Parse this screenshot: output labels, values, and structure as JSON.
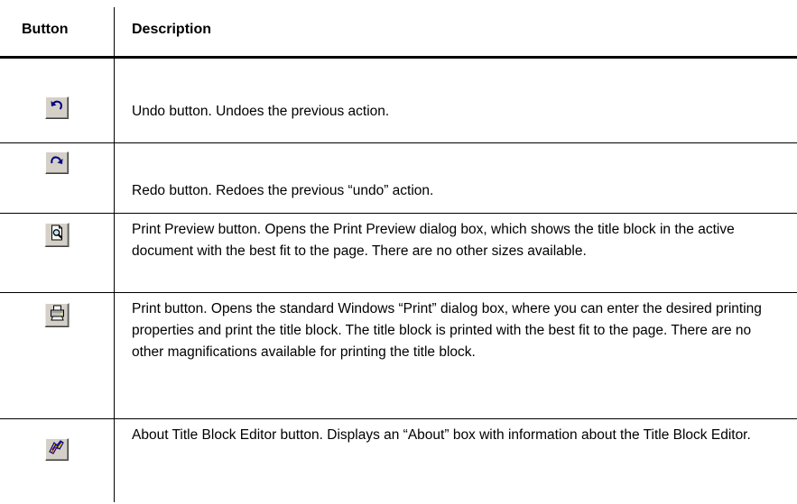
{
  "header": {
    "col_button": "Button",
    "col_description": "Description"
  },
  "rows": [
    {
      "icon": "undo-icon",
      "description": "Undo button. Undoes the previous action."
    },
    {
      "icon": "redo-icon",
      "description": "Redo button. Redoes the previous “undo” action."
    },
    {
      "icon": "print-preview-icon",
      "description": "Print Preview button. Opens the Print Preview dialog box, which shows the title block in the active document with the best fit to the page. There are no other sizes available."
    },
    {
      "icon": "printer-icon",
      "description": "Print button. Opens the standard Windows “Print” dialog box, where you can enter the desired printing properties and print the title block. The title block is printed with the best fit to the page. There are no other magnifications available for printing the title block."
    },
    {
      "icon": "about-icon",
      "description": "About Title Block Editor button. Displays an “About” box with information about the Title Block Editor."
    }
  ]
}
